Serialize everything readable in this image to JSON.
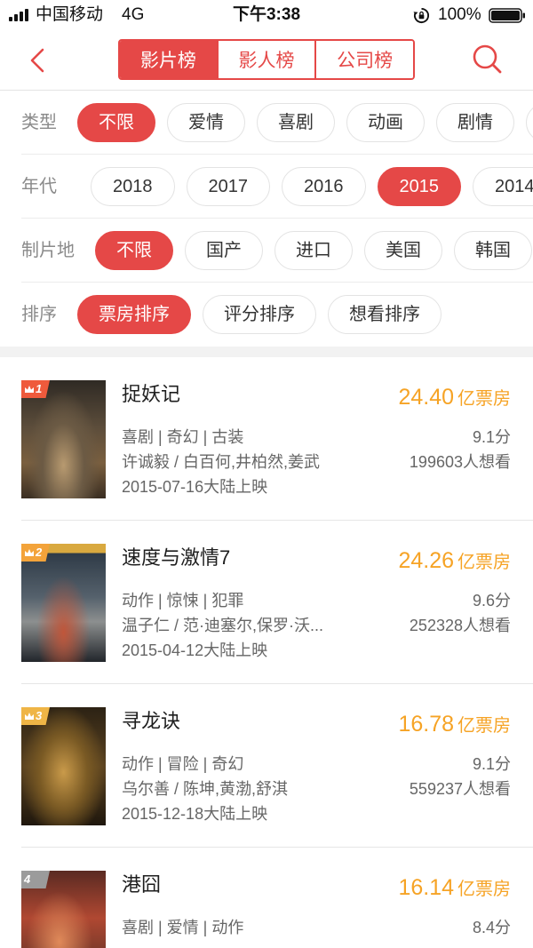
{
  "status_bar": {
    "carrier": "中国移动",
    "network": "4G",
    "time": "下午3:38",
    "battery": "100%",
    "icons": {
      "signal": "signal-icon",
      "rotation_lock": "rotation-lock-icon",
      "battery": "battery-icon"
    }
  },
  "header": {
    "back_icon": "chevron-left-icon",
    "search_icon": "search-icon",
    "tabs": [
      {
        "label": "影片榜",
        "selected": true
      },
      {
        "label": "影人榜",
        "selected": false
      },
      {
        "label": "公司榜",
        "selected": false
      }
    ]
  },
  "filters": [
    {
      "label": "类型",
      "options": [
        {
          "label": "不限",
          "selected": true
        },
        {
          "label": "爱情",
          "selected": false
        },
        {
          "label": "喜剧",
          "selected": false
        },
        {
          "label": "动画",
          "selected": false
        },
        {
          "label": "剧情",
          "selected": false
        }
      ]
    },
    {
      "label": "年代",
      "options": [
        {
          "label": "2018",
          "selected": false
        },
        {
          "label": "2017",
          "selected": false
        },
        {
          "label": "2016",
          "selected": false
        },
        {
          "label": "2015",
          "selected": true
        },
        {
          "label": "2014",
          "selected": false
        }
      ]
    },
    {
      "label": "制片地",
      "options": [
        {
          "label": "不限",
          "selected": true
        },
        {
          "label": "国产",
          "selected": false
        },
        {
          "label": "进口",
          "selected": false
        },
        {
          "label": "美国",
          "selected": false
        },
        {
          "label": "韩国",
          "selected": false
        }
      ]
    },
    {
      "label": "排序",
      "options": [
        {
          "label": "票房排序",
          "selected": true
        },
        {
          "label": "评分排序",
          "selected": false
        },
        {
          "label": "想看排序",
          "selected": false
        }
      ]
    }
  ],
  "movies": [
    {
      "rank": "1",
      "crown": true,
      "badge_color": "#ef5a3c",
      "title": "捉妖记",
      "box_office": "24.40",
      "box_office_unit": "亿票房",
      "genres": "喜剧 | 奇幻 | 古装",
      "score": "9.1分",
      "credits": "许诚毅 / 白百何,井柏然,姜武",
      "want": "199603人想看",
      "release": "2015-07-16大陆上映"
    },
    {
      "rank": "2",
      "crown": true,
      "badge_color": "#f3a33a",
      "title": "速度与激情7",
      "box_office": "24.26",
      "box_office_unit": "亿票房",
      "genres": "动作 | 惊悚 | 犯罪",
      "score": "9.6分",
      "credits": "温子仁 / 范·迪塞尔,保罗·沃...",
      "want": "252328人想看",
      "release": "2015-04-12大陆上映"
    },
    {
      "rank": "3",
      "crown": true,
      "badge_color": "#efb546",
      "title": "寻龙诀",
      "box_office": "16.78",
      "box_office_unit": "亿票房",
      "genres": "动作 | 冒险 | 奇幻",
      "score": "9.1分",
      "credits": "乌尔善 / 陈坤,黄渤,舒淇",
      "want": "559237人想看",
      "release": "2015-12-18大陆上映"
    },
    {
      "rank": "4",
      "crown": false,
      "badge_color": "#9b9b9b",
      "title": "港囧",
      "box_office": "16.14",
      "box_office_unit": "亿票房",
      "genres": "喜剧 | 爱情 | 动作",
      "score": "8.4分"
    }
  ],
  "colors": {
    "accent": "#e54847",
    "box_office": "#f6a325"
  }
}
